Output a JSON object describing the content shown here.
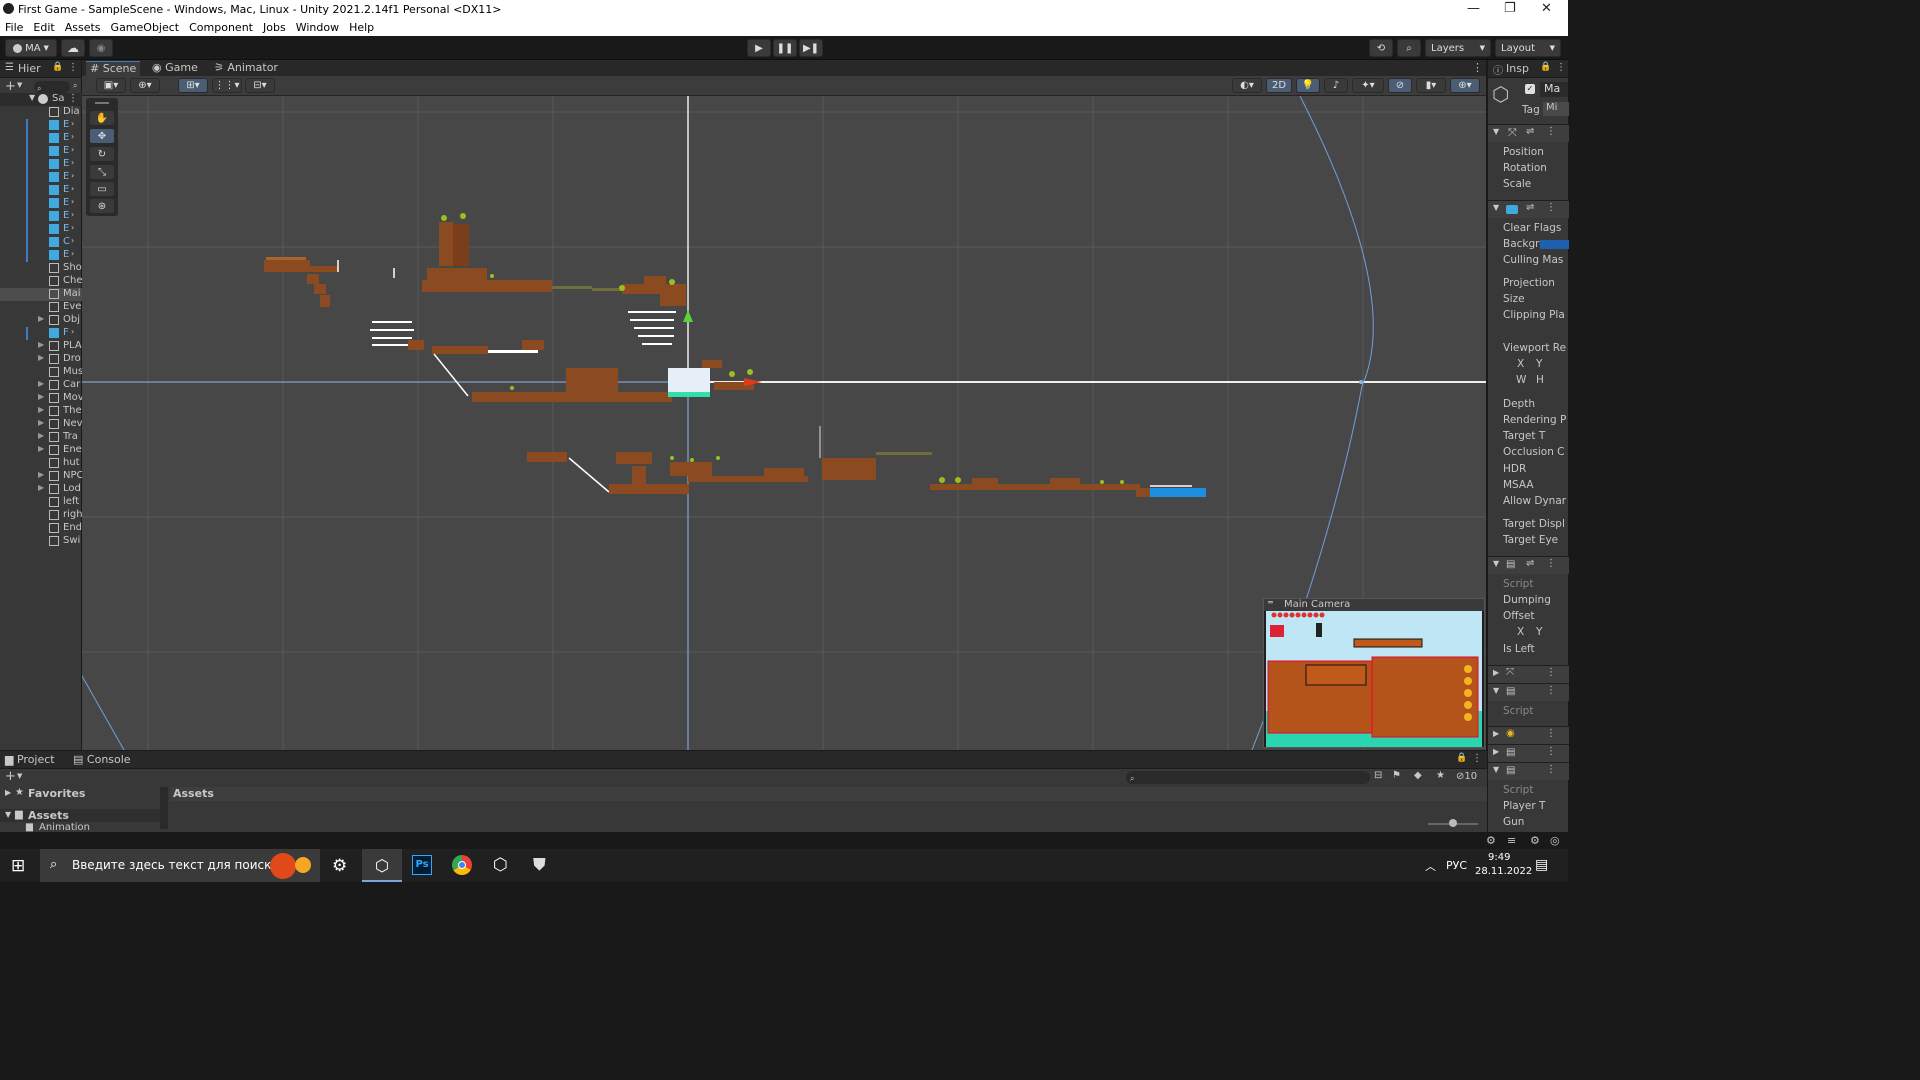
{
  "window": {
    "title": "First Game - SampleScene - Windows, Mac, Linux - Unity 2021.2.14f1 Personal <DX11>",
    "controls": [
      "—",
      "❐",
      "✕"
    ]
  },
  "menu": [
    "File",
    "Edit",
    "Assets",
    "GameObject",
    "Component",
    "Jobs",
    "Window",
    "Help"
  ],
  "toolbar": {
    "account": "MA",
    "layers_label": "Layers",
    "layout_label": "Layout"
  },
  "hierarchy": {
    "tab_label": "Hier",
    "scene_name": "Sa",
    "items": [
      {
        "name": "Dia",
        "kind": "go",
        "expand": false,
        "prefab": false
      },
      {
        "name": "E",
        "kind": "prefab",
        "expand": true,
        "prefab": true
      },
      {
        "name": "E",
        "kind": "prefab",
        "expand": true,
        "prefab": true
      },
      {
        "name": "E",
        "kind": "prefab",
        "expand": true,
        "prefab": true
      },
      {
        "name": "E",
        "kind": "prefab",
        "expand": true,
        "prefab": true
      },
      {
        "name": "E",
        "kind": "prefab",
        "expand": true,
        "prefab": true
      },
      {
        "name": "E",
        "kind": "prefab",
        "expand": true,
        "prefab": true
      },
      {
        "name": "E",
        "kind": "prefab",
        "expand": true,
        "prefab": true
      },
      {
        "name": "E",
        "kind": "prefab",
        "expand": true,
        "prefab": true
      },
      {
        "name": "E",
        "kind": "prefab",
        "expand": true,
        "prefab": true
      },
      {
        "name": "C",
        "kind": "prefab",
        "expand": true,
        "prefab": true
      },
      {
        "name": "E",
        "kind": "prefab",
        "expand": true,
        "prefab": true
      },
      {
        "name": "Sho",
        "kind": "go",
        "expand": false,
        "prefab": false
      },
      {
        "name": "Che",
        "kind": "go",
        "expand": false,
        "prefab": false
      },
      {
        "name": "Mai",
        "kind": "go",
        "expand": false,
        "prefab": false,
        "selected": true
      },
      {
        "name": "Eve",
        "kind": "go",
        "expand": false,
        "prefab": false
      },
      {
        "name": "Obj",
        "kind": "go",
        "expand": true,
        "prefab": false
      },
      {
        "name": "F",
        "kind": "prefab",
        "expand": true,
        "prefab": true
      },
      {
        "name": "PLA",
        "kind": "go",
        "expand": true,
        "prefab": false
      },
      {
        "name": "Dro",
        "kind": "go",
        "expand": true,
        "prefab": false
      },
      {
        "name": "Mus",
        "kind": "go",
        "expand": false,
        "prefab": false
      },
      {
        "name": "Car",
        "kind": "go",
        "expand": true,
        "prefab": false
      },
      {
        "name": "Mov",
        "kind": "go",
        "expand": true,
        "prefab": false
      },
      {
        "name": "The",
        "kind": "go",
        "expand": true,
        "prefab": false
      },
      {
        "name": "Nev",
        "kind": "go",
        "expand": true,
        "prefab": false
      },
      {
        "name": "Tra",
        "kind": "go",
        "expand": true,
        "prefab": false
      },
      {
        "name": "Ene",
        "kind": "go",
        "expand": true,
        "prefab": false
      },
      {
        "name": "hut",
        "kind": "go",
        "expand": false,
        "prefab": false
      },
      {
        "name": "NPC",
        "kind": "go",
        "expand": true,
        "prefab": false
      },
      {
        "name": "Lod",
        "kind": "go",
        "expand": true,
        "prefab": false
      },
      {
        "name": "left",
        "kind": "go",
        "expand": false,
        "prefab": false
      },
      {
        "name": "righ",
        "kind": "go",
        "expand": false,
        "prefab": false
      },
      {
        "name": "End",
        "kind": "go",
        "expand": false,
        "prefab": false
      },
      {
        "name": "Swi",
        "kind": "go",
        "expand": false,
        "prefab": false
      }
    ]
  },
  "scene_view": {
    "tabs": [
      "Scene",
      "Game",
      "Animator"
    ],
    "mode_2d": "2D",
    "camera_preview_title": "Main Camera"
  },
  "inspector": {
    "tab_label": "Insp",
    "object_name": "Ma",
    "tag_label": "Tag",
    "tag_value": "Mi",
    "transform_fields": [
      "Position",
      "Rotation",
      "Scale"
    ],
    "camera_fields": [
      "Clear Flags",
      "Backgro",
      "Culling Mas",
      "Projection",
      "Size",
      "Clipping Pla",
      "Viewport Re",
      "Depth",
      "Rendering P",
      "Target T",
      "Occlusion C",
      "HDR",
      "MSAA",
      "Allow Dynar",
      "Target Displ",
      "Target Eye"
    ],
    "viewport_x": "X",
    "viewport_y": "Y",
    "viewport_w": "W",
    "viewport_h": "H",
    "script_fields": [
      "Script",
      "Dumping",
      "Offset",
      "Is Left"
    ],
    "offset_x": "X",
    "offset_y": "Y",
    "script2": "Script",
    "script3_fields": [
      "Script",
      "Player T",
      "Gun"
    ]
  },
  "project": {
    "tabs": [
      "Project",
      "Console"
    ],
    "favorites_label": "Favorites",
    "assets_label": "Assets",
    "animation_label": "Animation",
    "breadcrumb": "Assets",
    "hidden_count": "10"
  },
  "taskbar": {
    "search_placeholder": "Введите здесь текст для поиска",
    "language": "РУС",
    "time": "9:49",
    "date": "28.11.2022",
    "ps_label": "Ps"
  },
  "colors": {
    "accent": "#3a79bb",
    "viewport_bg": "#474747",
    "panel_bg": "#383838",
    "dirt": "#8b4a1f",
    "grass": "#9bbf1f"
  }
}
